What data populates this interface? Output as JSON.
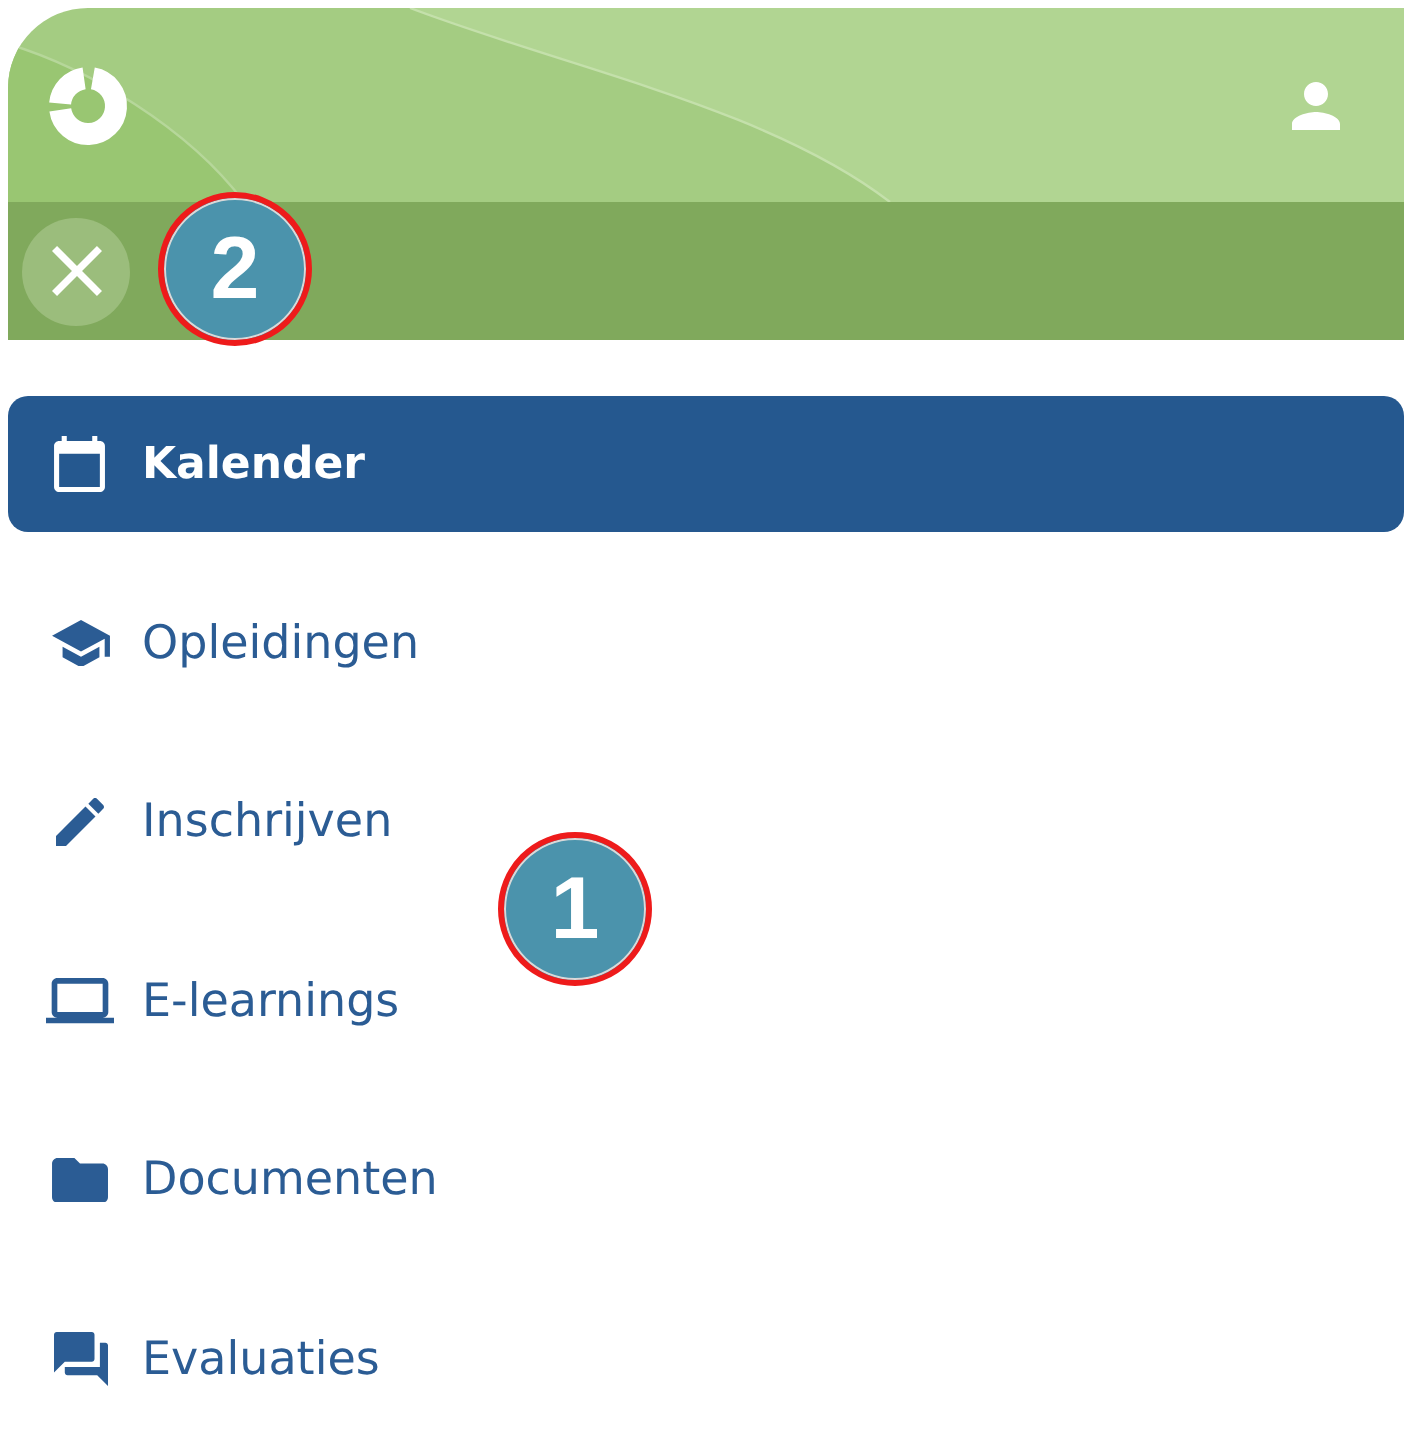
{
  "menu": {
    "items": [
      {
        "label": "Kalender",
        "selected": true
      },
      {
        "label": "Opleidingen",
        "selected": false
      },
      {
        "label": "Inschrijven",
        "selected": false
      },
      {
        "label": "E-learnings",
        "selected": false
      },
      {
        "label": "Documenten",
        "selected": false
      },
      {
        "label": "Evaluaties",
        "selected": false
      }
    ]
  },
  "callouts": [
    {
      "number": "2"
    },
    {
      "number": "1"
    }
  ]
}
